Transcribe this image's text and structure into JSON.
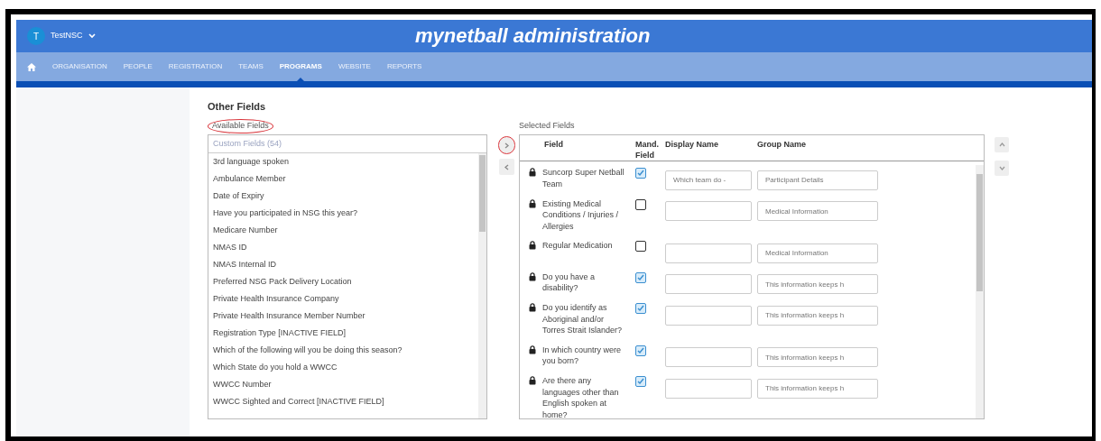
{
  "header": {
    "avatar_initial": "T",
    "user_name": "TestNSC",
    "title": "mynetball administration"
  },
  "nav": [
    {
      "label": "ORGANISATION",
      "selected": false
    },
    {
      "label": "PEOPLE",
      "selected": false
    },
    {
      "label": "REGISTRATION",
      "selected": false
    },
    {
      "label": "TEAMS",
      "selected": false
    },
    {
      "label": "PROGRAMS",
      "selected": true
    },
    {
      "label": "WEBSITE",
      "selected": false
    },
    {
      "label": "REPORTS",
      "selected": false
    }
  ],
  "section_title": "Other Fields",
  "available": {
    "label": "Available Fields",
    "highlighted": true,
    "placeholder": "Custom Fields (54)",
    "items": [
      "3rd language spoken",
      "Ambulance Member",
      "Date of Expiry",
      "Have you participated in NSG this year?",
      "Medicare Number",
      "NMAS ID",
      "NMAS Internal ID",
      "Preferred NSG Pack Delivery Location",
      "Private Health Insurance Company",
      "Private Health Insurance Member Number",
      "Registration Type [INACTIVE FIELD]",
      "Which of the following will you be doing this season?",
      "Which State do you hold a WWCC",
      "WWCC Number",
      "WWCC Sighted and Correct [INACTIVE FIELD]"
    ]
  },
  "move_buttons": [
    {
      "kind": "add",
      "highlighted": true
    },
    {
      "kind": "remove",
      "highlighted": false
    }
  ],
  "selected": {
    "label": "Selected Fields",
    "columns": [
      "Field",
      "Mand. Field",
      "Display Name",
      "Group Name"
    ],
    "rows": [
      {
        "field": "Suncorp Super Netball Team",
        "mandatory": true,
        "display_name": "Which team do -",
        "group_name": "Participant Details"
      },
      {
        "field": "Existing Medical Conditions / Injuries / Allergies",
        "mandatory": false,
        "group_name": "Medical Information"
      },
      {
        "field": "Regular Medication",
        "mandatory": false,
        "group_name": "Medical Information"
      },
      {
        "field": "Do you have a disability?",
        "mandatory": true,
        "group_name": "This information keeps h"
      },
      {
        "field": "Do you identify as Aboriginal and/or Torres Strait Islander?",
        "mandatory": true,
        "group_name": "This information keeps h"
      },
      {
        "field": "In which country were you born?",
        "mandatory": true,
        "group_name": "This information keeps h"
      },
      {
        "field": "Are there any languages other than English spoken at home?",
        "mandatory": true,
        "group_name": "This information keeps h"
      }
    ]
  },
  "order_buttons": [
    {
      "kind": "up"
    },
    {
      "kind": "down"
    }
  ]
}
